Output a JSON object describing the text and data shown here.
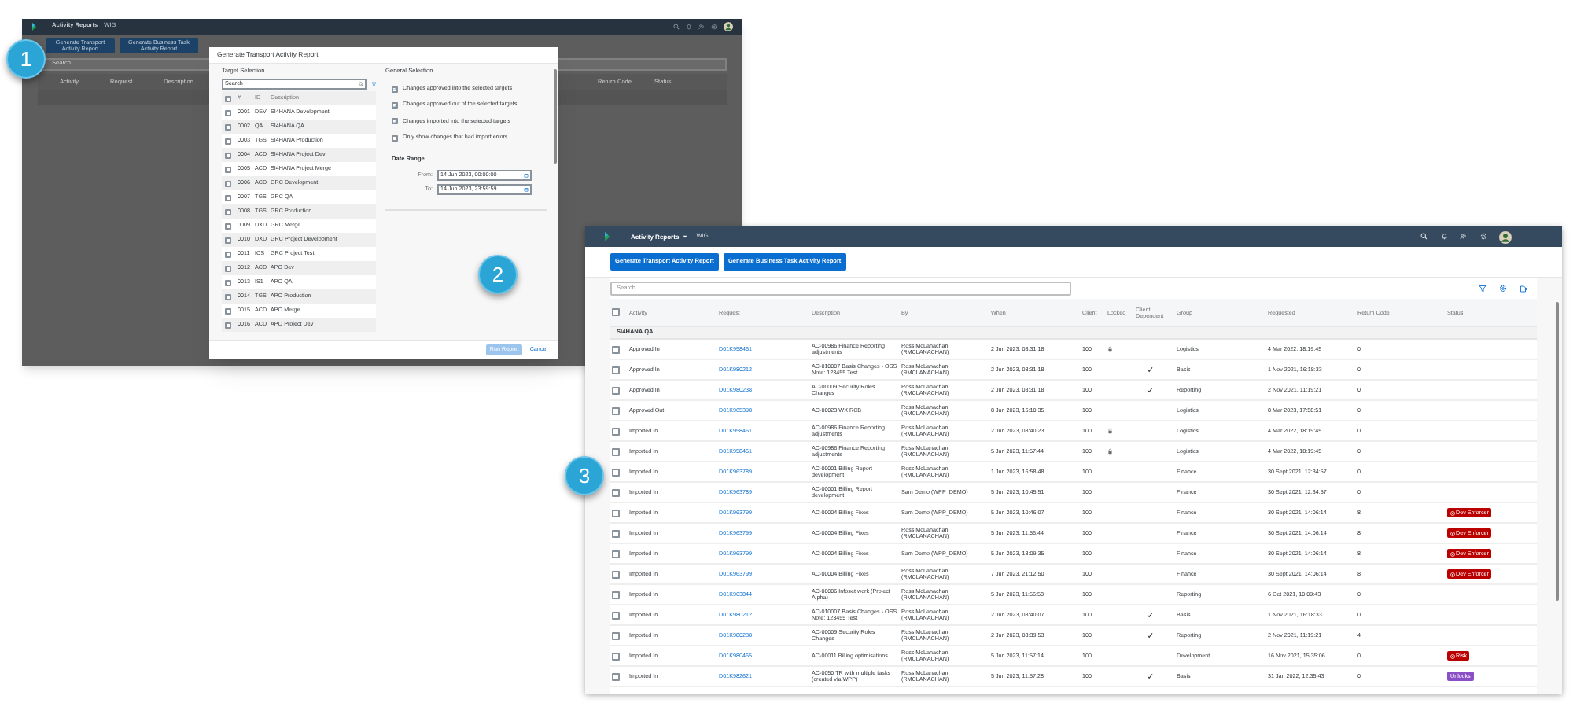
{
  "back_window": {
    "app_title": "Activity Reports",
    "system": "WIG",
    "buttons": [
      "Generate Transport Activity Report",
      "Generate Business Task Activity Report"
    ],
    "search_placeholder": "Search",
    "columns": [
      "Activity",
      "Request",
      "Description",
      "Return Code",
      "Status"
    ]
  },
  "dialog": {
    "title": "Generate Transport Activity Report",
    "target_selection": {
      "heading": "Target Selection",
      "search_placeholder": "Search",
      "select_all_checked": false,
      "columns": [
        "#",
        "ID",
        "Description"
      ],
      "rows": [
        {
          "number": "0001",
          "id": "DEV",
          "description": "SI4HANA Development",
          "checked": false
        },
        {
          "number": "0002",
          "id": "QA",
          "description": "SI4HANA QA",
          "checked": false
        },
        {
          "number": "0003",
          "id": "TGS",
          "description": "SI4HANA Production",
          "checked": false
        },
        {
          "number": "0004",
          "id": "ACD",
          "description": "SI4HANA Project Dev",
          "checked": false
        },
        {
          "number": "0005",
          "id": "ACD",
          "description": "SI4HANA Project Merge",
          "checked": false
        },
        {
          "number": "0006",
          "id": "ACD",
          "description": "GRC Development",
          "checked": false
        },
        {
          "number": "0007",
          "id": "TGS",
          "description": "GRC QA",
          "checked": false
        },
        {
          "number": "0008",
          "id": "TGS",
          "description": "GRC Production",
          "checked": false
        },
        {
          "number": "0009",
          "id": "DXD",
          "description": "GRC Merge",
          "checked": false
        },
        {
          "number": "0010",
          "id": "DXD",
          "description": "GRC Project Development",
          "checked": false
        },
        {
          "number": "0011",
          "id": "ICS",
          "description": "GRC Project Test",
          "checked": false
        },
        {
          "number": "0012",
          "id": "ACD",
          "description": "APO Dev",
          "checked": false
        },
        {
          "number": "0013",
          "id": "IS1",
          "description": "APO QA",
          "checked": false
        },
        {
          "number": "0014",
          "id": "TGS",
          "description": "APO Production",
          "checked": false
        },
        {
          "number": "0015",
          "id": "ACD",
          "description": "APO Merge",
          "checked": false
        },
        {
          "number": "0016",
          "id": "ACD",
          "description": "APO Project Dev",
          "checked": false
        }
      ]
    },
    "general_selection": {
      "heading": "General Selection",
      "options": [
        {
          "label": "Changes approved into the selected targets",
          "checked": true
        },
        {
          "label": "Changes approved out of the selected targets",
          "checked": true
        },
        {
          "label": "Changes imported into the selected targets",
          "checked": true
        },
        {
          "label": "Only show changes that had import errors",
          "checked": false
        }
      ]
    },
    "date_range": {
      "heading": "Date Range",
      "fields": [
        {
          "label": "From:",
          "value": "14 Jun 2023, 00:00:00"
        },
        {
          "label": "To:",
          "value": "14 Jun 2023, 23:59:59"
        }
      ]
    },
    "buttons": [
      {
        "label": "Run Report",
        "kind": "primary",
        "disabled": true
      },
      {
        "label": "Cancel",
        "kind": "secondary",
        "disabled": false
      }
    ]
  },
  "front_window": {
    "app_title": "Activity Reports",
    "system": "WIG",
    "buttons": [
      "Generate Transport Activity Report",
      "Generate Business Task Activity Report"
    ],
    "search_placeholder": "Search",
    "table": {
      "select_all_checked": false,
      "columns": [
        "Activity",
        "Request",
        "Description",
        "By",
        "When",
        "Client",
        "Locked",
        "Client Dependent",
        "Group",
        "Requested",
        "Return Code",
        "Status"
      ],
      "group": "SI4HANA QA",
      "rows": [
        {
          "checked": false,
          "activity": "Approved In",
          "request": "D01K958461",
          "description": "AC-00986 Finance Reporting adjustments",
          "by": "Ross McLanachan (RMCLANACHAN)",
          "when": "2 Jun 2023, 08:31:18",
          "client": "100",
          "locked": true,
          "client_dependent": false,
          "group": "Logistics",
          "requested": "4 Mar 2022, 18:19:45",
          "return_code": "0"
        },
        {
          "checked": false,
          "activity": "Approved In",
          "request": "D01K980212",
          "description": "AC-010007 Basis Changes - OSS Note: 123455 Test",
          "by": "Ross McLanachan (RMCLANACHAN)",
          "when": "2 Jun 2023, 08:31:18",
          "client": "100",
          "locked": false,
          "client_dependent": true,
          "group": "Basis",
          "requested": "1 Nov 2021, 16:18:33",
          "return_code": "0"
        },
        {
          "checked": false,
          "activity": "Approved In",
          "request": "D01K980238",
          "description": "AC-00009 Security Roles Changes",
          "by": "Ross McLanachan (RMCLANACHAN)",
          "when": "2 Jun 2023, 08:31:18",
          "client": "100",
          "locked": false,
          "client_dependent": true,
          "group": "Reporting",
          "requested": "2 Nov 2021, 11:19:21",
          "return_code": "0"
        },
        {
          "checked": false,
          "activity": "Approved Out",
          "request": "D01K965398",
          "description": "AC-00023 WX RCB",
          "by": "Ross McLanachan (RMCLANACHAN)",
          "when": "8 Jun 2023, 16:10:35",
          "client": "100",
          "locked": false,
          "client_dependent": false,
          "group": "Logistics",
          "requested": "8 Mar 2023, 17:58:51",
          "return_code": "0"
        },
        {
          "checked": false,
          "activity": "Imported In",
          "request": "D01K958461",
          "description": "AC-00986 Finance Reporting adjustments",
          "by": "Ross McLanachan (RMCLANACHAN)",
          "when": "2 Jun 2023, 08:40:23",
          "client": "100",
          "locked": true,
          "client_dependent": false,
          "group": "Logistics",
          "requested": "4 Mar 2022, 18:19:45",
          "return_code": "0"
        },
        {
          "checked": false,
          "activity": "Imported In",
          "request": "D01K958461",
          "description": "AC-00986 Finance Reporting adjustments",
          "by": "Ross McLanachan (RMCLANACHAN)",
          "when": "5 Jun 2023, 11:57:44",
          "client": "100",
          "locked": true,
          "client_dependent": false,
          "group": "Logistics",
          "requested": "4 Mar 2022, 18:19:45",
          "return_code": "0"
        },
        {
          "checked": false,
          "activity": "Imported In",
          "request": "D01K963789",
          "description": "AC-00001 Billing Report development",
          "by": "Ross McLanachan (RMCLANACHAN)",
          "when": "1 Jun 2023, 16:58:48",
          "client": "100",
          "locked": false,
          "client_dependent": false,
          "group": "Finance",
          "requested": "30 Sept 2021, 12:34:57",
          "return_code": "0"
        },
        {
          "checked": false,
          "activity": "Imported In",
          "request": "D01K963789",
          "description": "AC-00001 Billing Report development",
          "by": "Sam Demo (WPP_DEMO)",
          "when": "5 Jun 2023, 10:45:51",
          "client": "100",
          "locked": false,
          "client_dependent": false,
          "group": "Finance",
          "requested": "30 Sept 2021, 12:34:57",
          "return_code": "0"
        },
        {
          "checked": false,
          "activity": "Imported In",
          "request": "D01K963799",
          "description": "AC-00004 Billing Fixes",
          "by": "Sam Demo (WPP_DEMO)",
          "when": "5 Jun 2023, 10:46:07",
          "client": "100",
          "locked": false,
          "client_dependent": false,
          "group": "Finance",
          "requested": "30 Sept 2021, 14:06:14",
          "return_code": "8",
          "status": {
            "label": "Dev Enforcer",
            "kind": "error"
          }
        },
        {
          "checked": false,
          "activity": "Imported In",
          "request": "D01K963799",
          "description": "AC-00004 Billing Fixes",
          "by": "Ross McLanachan (RMCLANACHAN)",
          "when": "5 Jun 2023, 11:56:44",
          "client": "100",
          "locked": false,
          "client_dependent": false,
          "group": "Finance",
          "requested": "30 Sept 2021, 14:06:14",
          "return_code": "8",
          "status": {
            "label": "Dev Enforcer",
            "kind": "error"
          }
        },
        {
          "checked": false,
          "activity": "Imported In",
          "request": "D01K963799",
          "description": "AC-00004 Billing Fixes",
          "by": "Sam Demo (WPP_DEMO)",
          "when": "5 Jun 2023, 13:09:35",
          "client": "100",
          "locked": false,
          "client_dependent": false,
          "group": "Finance",
          "requested": "30 Sept 2021, 14:06:14",
          "return_code": "8",
          "status": {
            "label": "Dev Enforcer",
            "kind": "error"
          }
        },
        {
          "checked": false,
          "activity": "Imported In",
          "request": "D01K963799",
          "description": "AC-00004 Billing Fixes",
          "by": "Ross McLanachan (RMCLANACHAN)",
          "when": "7 Jun 2023, 21:12:50",
          "client": "100",
          "locked": false,
          "client_dependent": false,
          "group": "Finance",
          "requested": "30 Sept 2021, 14:06:14",
          "return_code": "8",
          "status": {
            "label": "Dev Enforcer",
            "kind": "error"
          }
        },
        {
          "checked": false,
          "activity": "Imported In",
          "request": "D01K963844",
          "description": "AC-00006 Infoset work (Project Alpha)",
          "by": "Ross McLanachan (RMCLANACHAN)",
          "when": "5 Jun 2023, 11:56:58",
          "client": "100",
          "locked": false,
          "client_dependent": false,
          "group": "Reporting",
          "requested": "6 Oct 2021, 10:09:43",
          "return_code": "0"
        },
        {
          "checked": false,
          "activity": "Imported In",
          "request": "D01K980212",
          "description": "AC-010007 Basis Changes - OSS Note: 123455 Test",
          "by": "Ross McLanachan (RMCLANACHAN)",
          "when": "2 Jun 2023, 08:40:07",
          "client": "100",
          "locked": false,
          "client_dependent": true,
          "group": "Basis",
          "requested": "1 Nov 2021, 16:18:33",
          "return_code": "0"
        },
        {
          "checked": false,
          "activity": "Imported In",
          "request": "D01K980238",
          "description": "AC-00009 Security Roles Changes",
          "by": "Ross McLanachan (RMCLANACHAN)",
          "when": "2 Jun 2023, 08:39:53",
          "client": "100",
          "locked": false,
          "client_dependent": true,
          "group": "Reporting",
          "requested": "2 Nov 2021, 11:19:21",
          "return_code": "4"
        },
        {
          "checked": false,
          "activity": "Imported In",
          "request": "D01K980465",
          "description": "AC-00011 Billing optimisations",
          "by": "Ross McLanachan (RMCLANACHAN)",
          "when": "5 Jun 2023, 11:57:14",
          "client": "100",
          "locked": false,
          "client_dependent": false,
          "group": "Development",
          "requested": "16 Nov 2021, 15:35:06",
          "return_code": "0",
          "status": {
            "label": "Risk",
            "kind": "error"
          }
        },
        {
          "checked": false,
          "activity": "Imported In",
          "request": "D01K982621",
          "description": "AC-0050 TR with multiple tasks (created via WPP)",
          "by": "Ross McLanachan (RMCLANACHAN)",
          "when": "5 Jun 2023, 11:57:28",
          "client": "100",
          "locked": false,
          "client_dependent": true,
          "group": "Basis",
          "requested": "31 Jan 2022, 12:35:43",
          "return_code": "0",
          "status": {
            "label": "Unlocks",
            "kind": "info"
          }
        }
      ]
    }
  },
  "callouts": [
    "1",
    "2",
    "3"
  ]
}
